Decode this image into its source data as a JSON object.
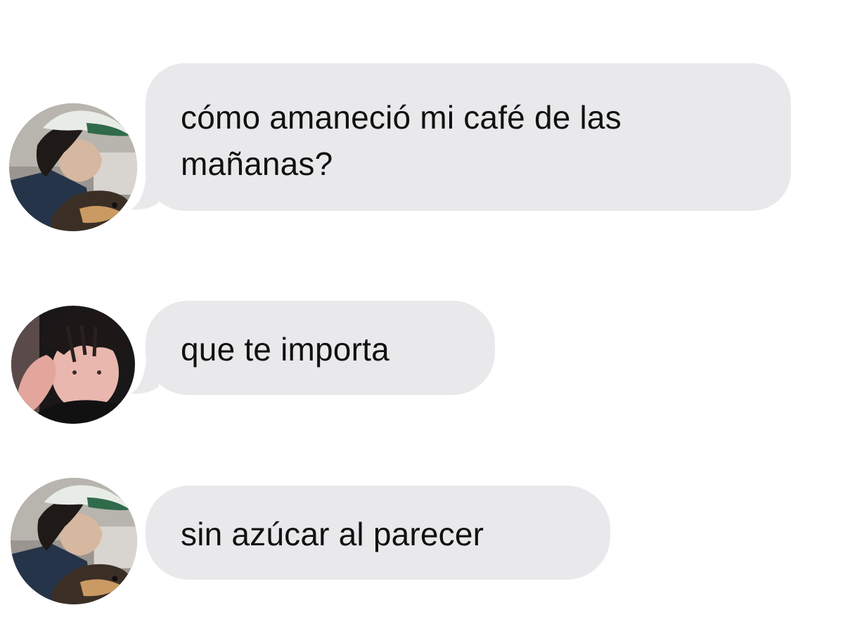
{
  "conversation": {
    "messages": [
      {
        "sender_avatar": "avatar-green-cap",
        "text": "cómo amaneció mi café de las mañanas?"
      },
      {
        "sender_avatar": "avatar-dark-hair",
        "text": "que te importa"
      },
      {
        "sender_avatar": "avatar-green-cap",
        "text": "sin azúcar al parecer"
      }
    ]
  },
  "colors": {
    "bubble_background": "#e9e9eb",
    "text": "#111111",
    "page_background": "#ffffff"
  }
}
